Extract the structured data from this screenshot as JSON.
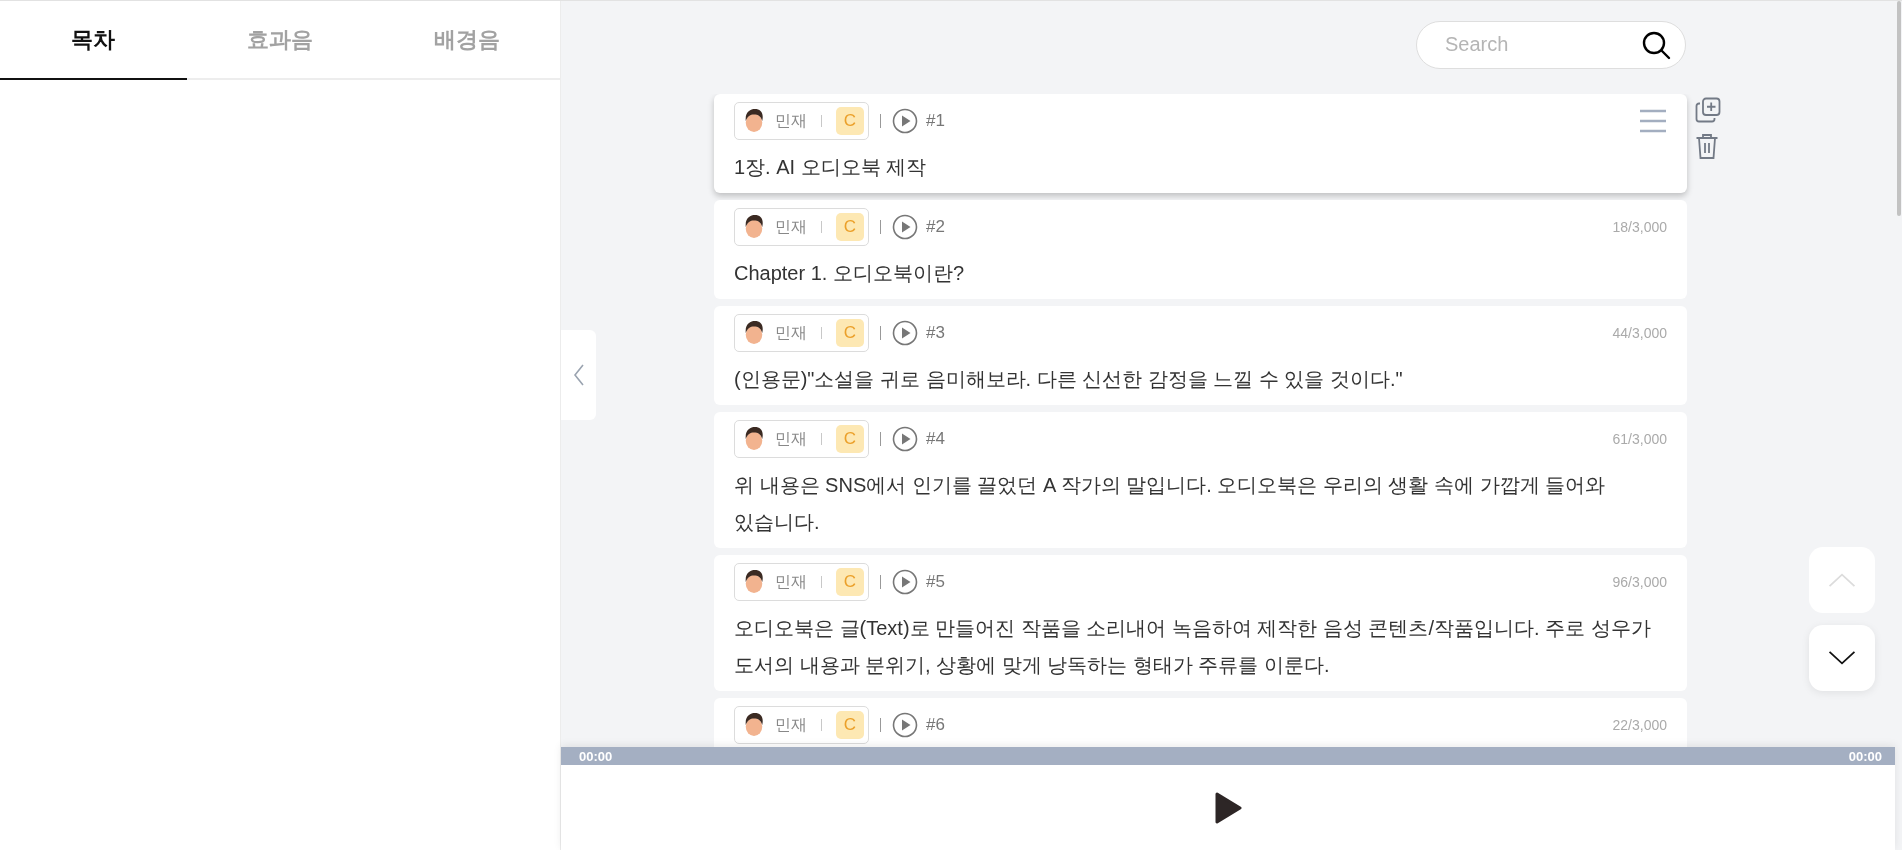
{
  "tabs": [
    {
      "label": "목차",
      "selected": true
    },
    {
      "label": "효과음",
      "selected": false
    },
    {
      "label": "배경음",
      "selected": false
    }
  ],
  "search": {
    "placeholder": "Search"
  },
  "blocks": [
    {
      "speaker": "민재",
      "badge": "C",
      "number": "#1",
      "active": true,
      "text": "1장. AI 오디오북 제작"
    },
    {
      "speaker": "민재",
      "badge": "C",
      "number": "#2",
      "count": "18/3,000",
      "active": false,
      "text": "Chapter 1. 오디오북이란?"
    },
    {
      "speaker": "민재",
      "badge": "C",
      "number": "#3",
      "count": "44/3,000",
      "active": false,
      "text": "(인용문)\"소설을 귀로 음미해보라. 다른 신선한 감정을 느낄 수 있을 것이다.\""
    },
    {
      "speaker": "민재",
      "badge": "C",
      "number": "#4",
      "count": "61/3,000",
      "active": false,
      "text": "위 내용은 SNS에서 인기를 끌었던 A 작가의 말입니다. 오디오북은 우리의 생활 속에 가깝게 들어와 있습니다."
    },
    {
      "speaker": "민재",
      "badge": "C",
      "number": "#5",
      "count": "96/3,000",
      "active": false,
      "text": "오디오북은 글(Text)로 만들어진 작품을 소리내어 녹음하여 제작한 음성 콘텐츠/작품입니다. 주로 성우가 도서의 내용과 분위기, 상황에 맞게 낭독하는 형태가 주류를 이룬다."
    },
    {
      "speaker": "민재",
      "badge": "C",
      "number": "#6",
      "count": "22/3,000",
      "active": false
    }
  ],
  "player": {
    "elapsed": "00:00",
    "duration": "00:00"
  }
}
